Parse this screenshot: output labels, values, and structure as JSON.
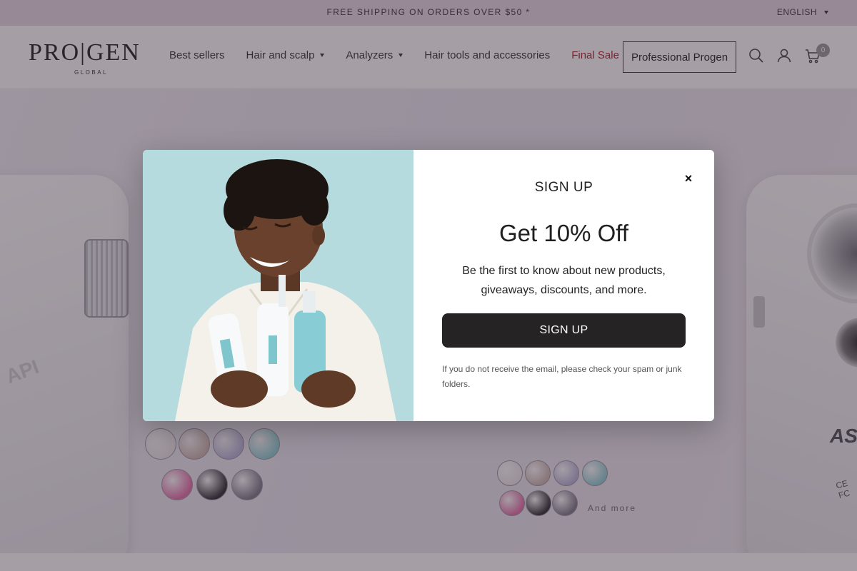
{
  "announcement": {
    "text": "FREE SHIPPING ON ORDERS OVER $50 *",
    "language": "ENGLISH"
  },
  "logo": {
    "wordmark": "PRO|GEN",
    "subtitle": "GLOBAL"
  },
  "nav": [
    {
      "label": "Best sellers",
      "has_dropdown": false
    },
    {
      "label": "Hair and scalp",
      "has_dropdown": true
    },
    {
      "label": "Analyzers",
      "has_dropdown": true
    },
    {
      "label": "Hair tools and accessories",
      "has_dropdown": false
    },
    {
      "label": "Final Sale",
      "has_dropdown": false
    }
  ],
  "header": {
    "professional_button": "Professional Progen",
    "icons": [
      "search-icon",
      "account-icon",
      "cart-icon"
    ],
    "cart_count": "0"
  },
  "hero": {
    "left_device_label": "API",
    "right_device_label": "AS",
    "right_device_mark": "CE FC",
    "and_more": "And more",
    "swatch_colors": [
      "#ece8ea",
      "#cdb8b0",
      "#b8b6d9",
      "#8fd0d4",
      "#e36fa9",
      "#2f2d31",
      "#7d7b88"
    ]
  },
  "modal": {
    "kicker": "SIGN UP",
    "title": "Get 10% Off",
    "description": "Be the first to know about new products, giveaways, discounts, and more.",
    "button": "SIGN UP",
    "note": "If you do not receive the email, please check your spam or junk folders.",
    "close": "×"
  },
  "colors": {
    "announcement_bg": "#e6dbe3",
    "sale": "#b11c2b",
    "button_dark": "#262324",
    "photo_bg": "#b6dbde"
  }
}
